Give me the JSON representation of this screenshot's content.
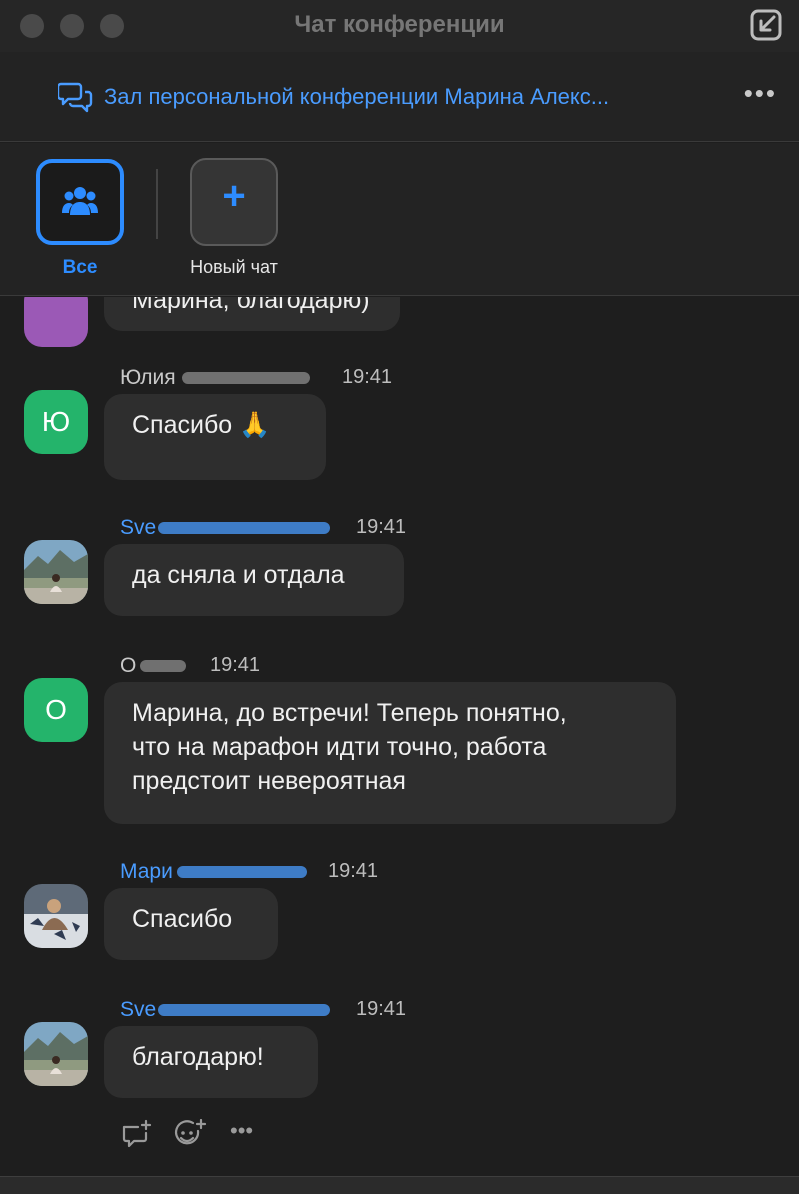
{
  "window": {
    "title": "Чат конференции",
    "traffic_lights": [
      "close",
      "minimize",
      "zoom"
    ],
    "popin_icon": "pop-in-window-icon"
  },
  "conference": {
    "name": "Зал персональной конференции Марина Алекс...",
    "icon": "chat-bubbles-icon",
    "more": "•••"
  },
  "filters": {
    "all_label": "Все",
    "all_icon": "group-people-icon",
    "new_chat_label": "Новый чат",
    "new_chat_icon": "+"
  },
  "messages": [
    {
      "sender": "",
      "time": "",
      "text": "Марина, благодарю)",
      "avatar": "purple"
    },
    {
      "sender": "Юлия",
      "time": "19:41",
      "text": "Спасибо 🙏",
      "avatar_letter": "Ю"
    },
    {
      "sender": "Sve",
      "time": "19:41",
      "text": "да сняла и отдала",
      "avatar": "photo-landscape"
    },
    {
      "sender": "О",
      "time": "19:41",
      "text": "Марина, до встречи! Теперь понятно,\nчто на марафон идти точно, работа\nпредстоит невероятная",
      "avatar_letter": "О"
    },
    {
      "sender": "Мари",
      "time": "19:41",
      "text": "Спасибо",
      "avatar": "photo-room"
    },
    {
      "sender": "Sve",
      "time": "19:41",
      "text": "благодарю!",
      "avatar": "photo-landscape"
    }
  ],
  "message_actions": [
    "reply-thread-icon",
    "emoji-reaction-icon",
    "more-icon"
  ],
  "message_actions_more": "•••",
  "colors": {
    "accent": "#2d8cff",
    "link": "#4a9cff",
    "avatar_green": "#24b46b",
    "bubble": "#2e2e2e",
    "background": "#1e1e1e"
  }
}
